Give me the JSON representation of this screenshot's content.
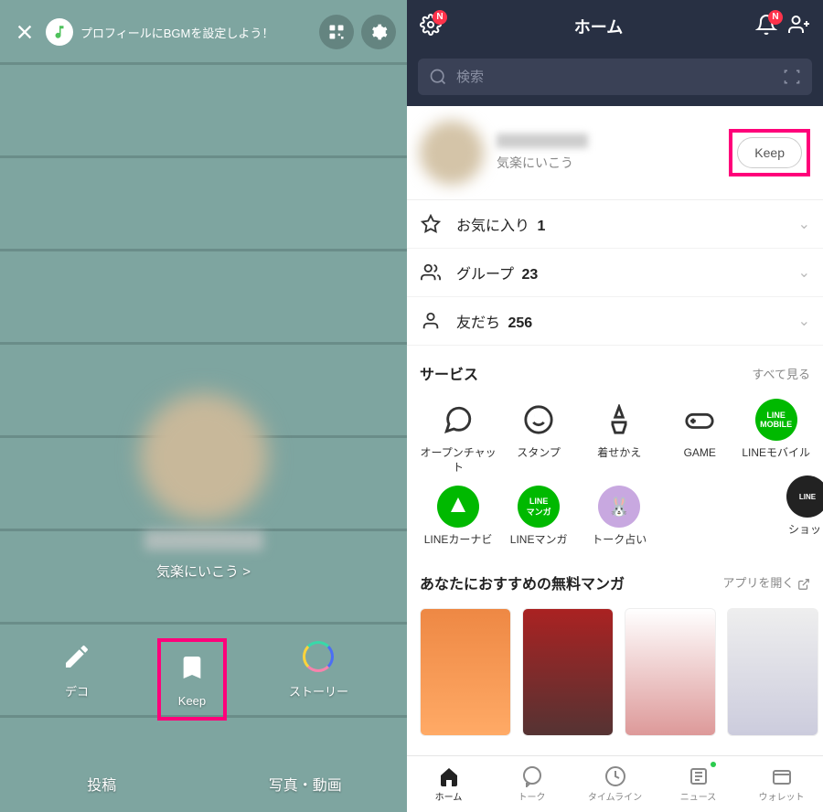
{
  "left": {
    "bgm_tip": "プロフィールにBGMを設定しよう！",
    "status": "気楽にいこう >",
    "actions": {
      "deco": "デコ",
      "keep": "Keep",
      "story": "ストーリー"
    },
    "tabs": {
      "post": "投稿",
      "photo": "写真・動画"
    }
  },
  "right": {
    "title": "ホーム",
    "search_placeholder": "検索",
    "profile_status": "気楽にいこう",
    "keep_btn": "Keep",
    "rows": {
      "favorites": {
        "label": "お気に入り",
        "count": "1"
      },
      "groups": {
        "label": "グループ",
        "count": "23"
      },
      "friends": {
        "label": "友だち",
        "count": "256"
      }
    },
    "services_title": "サービス",
    "see_all": "すべて見る",
    "services": [
      {
        "label": "オープンチャット"
      },
      {
        "label": "スタンプ"
      },
      {
        "label": "着せかえ"
      },
      {
        "label": "GAME"
      },
      {
        "label": "LINEモバイル"
      },
      {
        "label": "LINEカーナビ"
      },
      {
        "label": "LINEマンガ"
      },
      {
        "label": "トーク占い"
      },
      {
        "label": "ショッ"
      }
    ],
    "manga_title": "あなたにおすすめの無料マンガ",
    "open_app": "アプリを開く",
    "nav": {
      "home": "ホーム",
      "talk": "トーク",
      "timeline": "タイムライン",
      "news": "ニュース",
      "wallet": "ウォレット"
    }
  }
}
